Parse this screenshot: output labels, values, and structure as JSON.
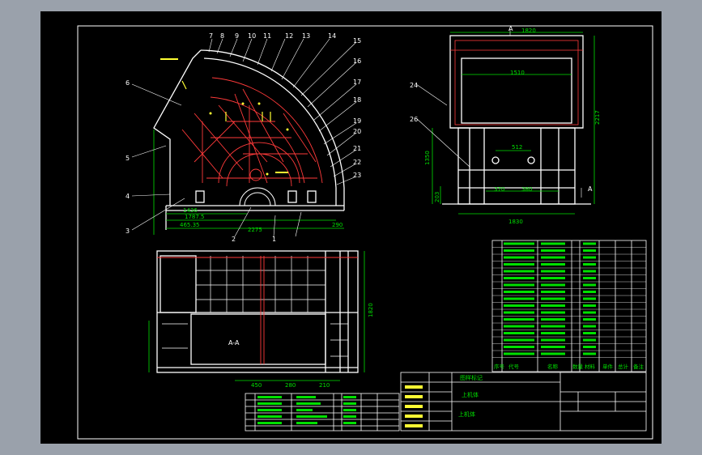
{
  "colors": {
    "window_bg": "#9aa1ab",
    "paper": "#000000",
    "frame": "#ffffff",
    "outline": "#ffffff",
    "hidden_line": "#ff3a3a",
    "dimension": "#00e000",
    "leader": "#ffffff",
    "accent": "#ffff33",
    "fill": "#cccccc"
  },
  "callouts": [
    "1",
    "2",
    "3",
    "4",
    "5",
    "6",
    "7",
    "8",
    "9",
    "10",
    "11",
    "12",
    "13",
    "14",
    "15",
    "16",
    "17",
    "18",
    "19",
    "20",
    "21",
    "22",
    "23",
    "24",
    "26"
  ],
  "dims": {
    "a": "1436",
    "b": "1787.5",
    "c": "465.35",
    "d": "2275",
    "e": "290",
    "f": "1820",
    "g": "1510",
    "h": "512",
    "i": "1350",
    "j": "2217",
    "k": "1830",
    "l": "370",
    "m": "380",
    "n": "203",
    "o": "450",
    "p": "280",
    "q": "210",
    "r": "1820"
  },
  "section_mark": "A",
  "section_label": "A-A",
  "title_block": {
    "heading": "图样标记",
    "drawing_name": "上机体",
    "material": "上机体"
  },
  "bom_header": [
    "序号",
    "代号",
    "名称",
    "数量",
    "材料",
    "单件",
    "总计",
    "备注"
  ]
}
